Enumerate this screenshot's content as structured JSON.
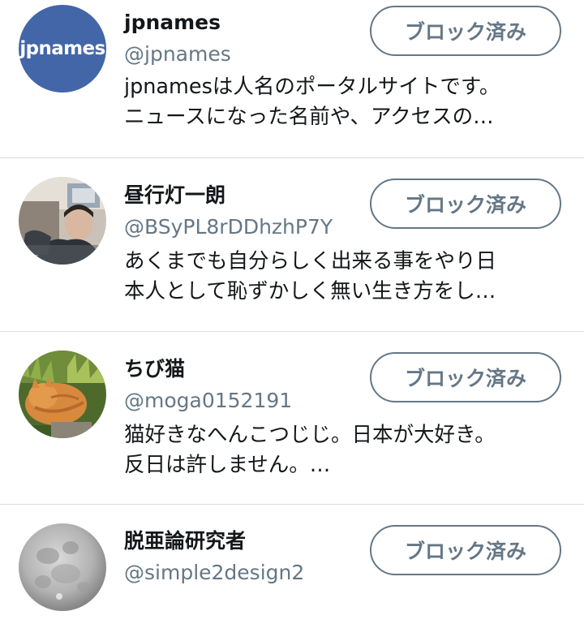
{
  "block_label": "ブロック済み",
  "users": [
    {
      "name": "jpnames",
      "handle": "@jpnames",
      "avatar_text": "jpnames",
      "bio_lines": [
        "jpnamesは人名のポータルサイトです。",
        "ニュースになった名前や、アクセスの…"
      ]
    },
    {
      "name": "昼行灯一朗",
      "handle": "@BSyPL8rDDhzhP7Y",
      "bio_lines": [
        "あくまでも自分らしく出来る事をやり日",
        "本人として恥ずかしく無い生き方をし…"
      ]
    },
    {
      "name": "ちび猫",
      "handle": "@moga0152191",
      "bio_lines": [
        "猫好きなへんこつじじ。日本が大好き。",
        "反日は許しません。…"
      ]
    },
    {
      "name": "脱亜論研究者",
      "handle": "@simple2design2",
      "bio_lines": []
    }
  ],
  "colors": {
    "text": "#14171a",
    "secondary": "#657786",
    "divider": "#d9dde1",
    "logo_bg": "#4266a8"
  }
}
